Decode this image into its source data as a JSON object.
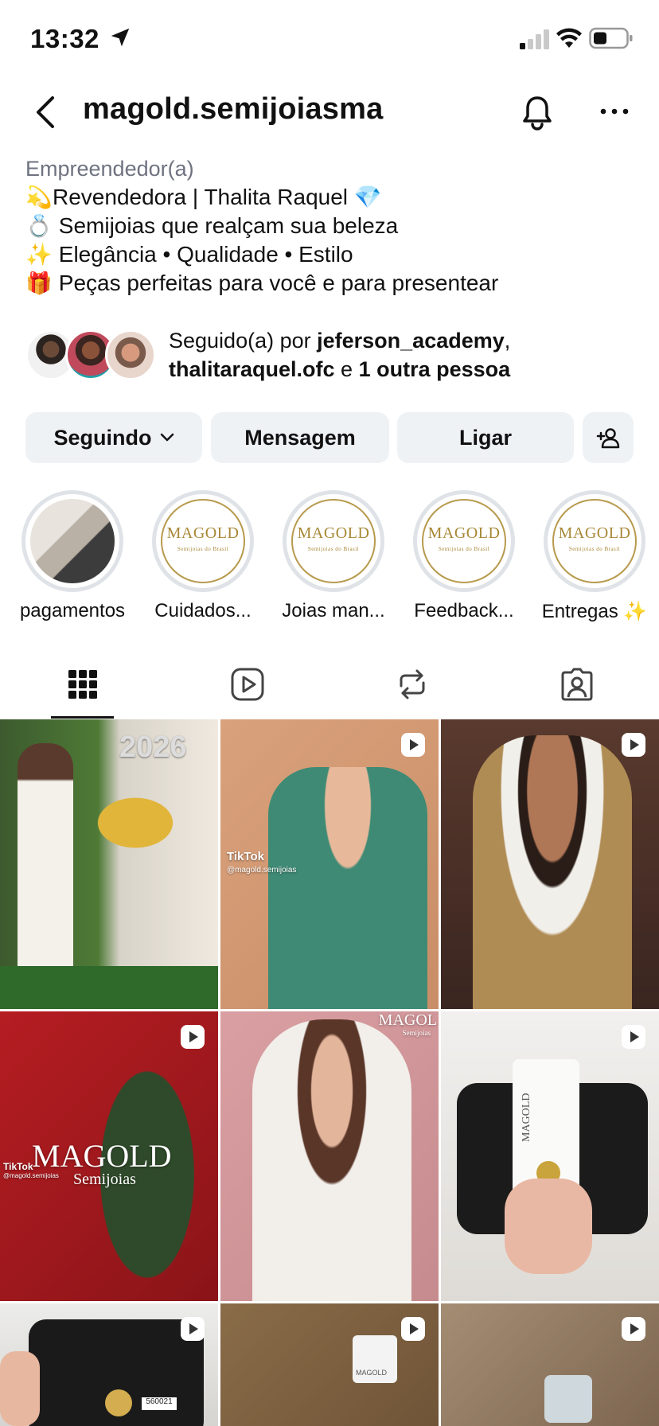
{
  "status_bar": {
    "time": "13:32"
  },
  "header": {
    "username": "magold.semijoiasma"
  },
  "bio": {
    "category": "Empreendedor(a)",
    "lines": [
      {
        "emoji": "💫",
        "text": "Revendedora | Thalita Raquel 💎"
      },
      {
        "emoji": "💍",
        "text": " Semijoias que realçam sua beleza"
      },
      {
        "emoji": "✨",
        "text": " Elegância • Qualidade • Estilo"
      },
      {
        "emoji": "🎁",
        "text": " Peças perfeitas para você e para presentear"
      }
    ]
  },
  "followed_by": {
    "prefix": "Seguido(a) por ",
    "user1": "jeferson_academy",
    "comma": ",",
    "user2": "thalitaraquel.ofc",
    "middle": " e ",
    "others": "1 outra pessoa"
  },
  "buttons": {
    "following": "Seguindo",
    "message": "Mensagem",
    "call": "Ligar"
  },
  "highlights": [
    {
      "label": "pagamentos"
    },
    {
      "label": "Cuidados..."
    },
    {
      "label": "Joias man..."
    },
    {
      "label": "Feedback..."
    },
    {
      "label": "Entregas ✨"
    }
  ],
  "logo": {
    "name": "MAGOLD",
    "sub": "Semijoias do Brasil"
  },
  "posts": {
    "tiktok_label": "TikTok",
    "tiktok_handle": "@magold.semijoias",
    "banner_2026": "2026",
    "magold_brand": "MAGOLD",
    "semijoias": "Semijoias",
    "tiktok_handle_2": "@magold.semijoias",
    "magold_corner": "MAGOL",
    "magold_corner_sub": "Semijoias",
    "card_text": "MAGOLD",
    "tag_text": "MAGOLD",
    "receipt_code": "560021"
  },
  "colors": {
    "accent_gold": "#a88836",
    "button_bg": "#eff2f5",
    "muted_text": "#6f7380"
  }
}
